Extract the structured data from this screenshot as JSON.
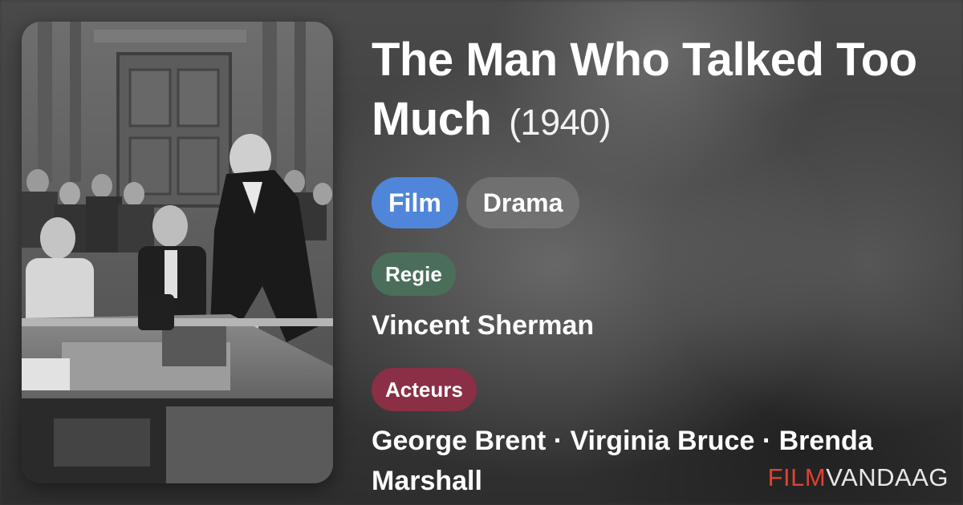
{
  "movie": {
    "title": "The Man Who Talked Too Much",
    "year": "(1940)",
    "type_label": "Film",
    "genre_label": "Drama",
    "director_heading": "Regie",
    "director": "Vincent Sherman",
    "cast_heading": "Acteurs",
    "cast": "George Brent · Virginia Bruce · Brenda Marshall"
  },
  "brand": {
    "part1": "FILM",
    "part2": "VANDAAG"
  },
  "colors": {
    "film_pill": "#4f86d9",
    "regie_badge": "#4b6e5a",
    "acteurs_badge": "#8a2f45",
    "brand_accent": "#e0412f"
  }
}
